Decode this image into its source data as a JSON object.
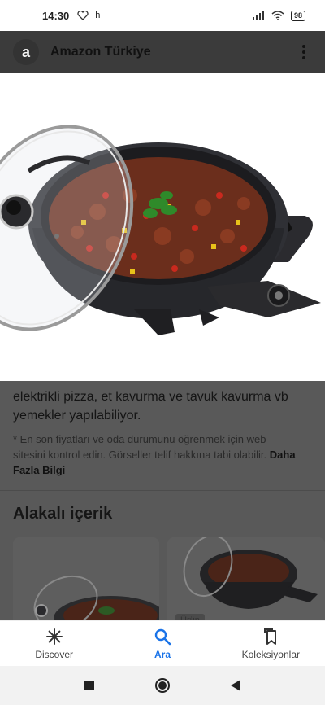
{
  "status_bar": {
    "time": "14:30",
    "extra_indicator": "h",
    "battery": "98"
  },
  "top_bar": {
    "logo_letter": "a",
    "site_name": "Amazon Türkiye"
  },
  "content": {
    "description": "elektrikli pizza, et kavurma ve tavuk kavurma vb yemekler yapılabiliyor.",
    "note": "* En son fiyatları ve oda durumunu öğrenmek için web sitesini kontrol edin. Görseller telif hakkına tabi olabilir.",
    "note_link": "Daha Fazla Bilgi",
    "related_title": "Alakalı içerik",
    "card_badge": "Ürün"
  },
  "bottom_nav": {
    "items": [
      {
        "label": "Discover",
        "icon": "asterisk-icon"
      },
      {
        "label": "Ara",
        "icon": "search-icon"
      },
      {
        "label": "Koleksiyonlar",
        "icon": "collections-icon"
      }
    ],
    "active_index": 1
  },
  "colors": {
    "accent": "#1a73e8",
    "overlay": "#595959"
  }
}
